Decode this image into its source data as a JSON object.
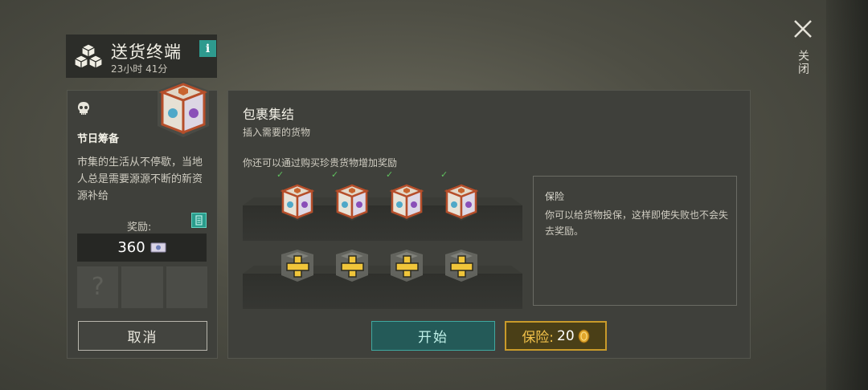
{
  "header": {
    "title": "送货终端",
    "timer": "23小时 41分",
    "info_label": "i"
  },
  "close": {
    "label": "关闭"
  },
  "event": {
    "title": "节日筹备",
    "description": "市集的生活从不停歇，当地人总是需要源源不断的新资源补给",
    "reward_label": "奖励:",
    "reward_value": "360",
    "slot_placeholder": "?"
  },
  "buttons": {
    "cancel": "取消",
    "start": "开始",
    "insurance_label": "保险:",
    "insurance_cost": "20"
  },
  "main": {
    "title": "包裹集结",
    "subtitle": "插入需要的货物",
    "note": "你还可以通过购买珍贵货物增加奖励",
    "filled_crates": 4,
    "empty_slots": 4
  },
  "insurance": {
    "title": "保险",
    "description": "你可以给货物投保，这样即使失败也不会失去奖励。"
  },
  "colors": {
    "accent_teal": "#2e9a8e",
    "gold": "#c99a2a",
    "check_green": "#5fc15f"
  },
  "icons": [
    "boxes-icon",
    "info-icon",
    "close-icon",
    "skull-icon",
    "crate-icon",
    "ticket-icon",
    "plus-icon",
    "coin-icon"
  ]
}
